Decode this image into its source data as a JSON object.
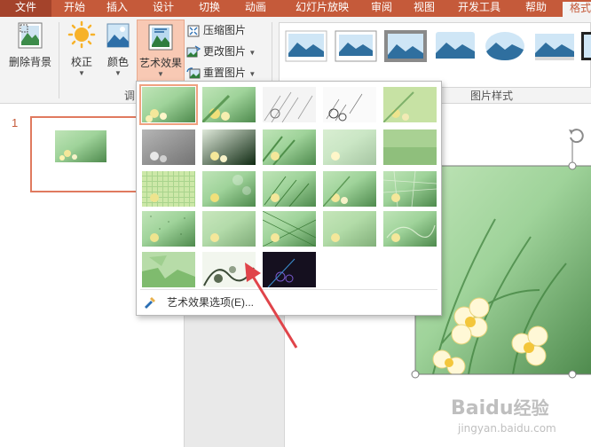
{
  "tabs": {
    "file": "文件",
    "home": "开始",
    "insert": "插入",
    "design": "设计",
    "transitions": "切换",
    "animations": "动画",
    "slideshow": "幻灯片放映",
    "review": "审阅",
    "view": "视图",
    "developer": "开发工具",
    "help": "帮助",
    "format": "格式"
  },
  "ribbon": {
    "remove_background": "删除背景",
    "corrections": "校正",
    "color": "颜色",
    "artistic_effects": "艺术效果",
    "compress_pictures": "压缩图片",
    "change_picture": "更改图片",
    "reset_picture": "重置图片",
    "adjust_group_label": "调",
    "picture_styles_label": "图片样式"
  },
  "slide_panel": {
    "slide_number": "1"
  },
  "artistic_effects_menu": {
    "options_label": "艺术效果选项(E)..."
  },
  "colors": {
    "accent": "#c55a3a",
    "tab_bar": "#c55a3a",
    "selection_outline": "#f0a180",
    "arrow": "#e0444a"
  },
  "watermark": {
    "logo_text": "Baidu",
    "logo_cn": "经验",
    "url": "jingyan.baidu.com"
  }
}
